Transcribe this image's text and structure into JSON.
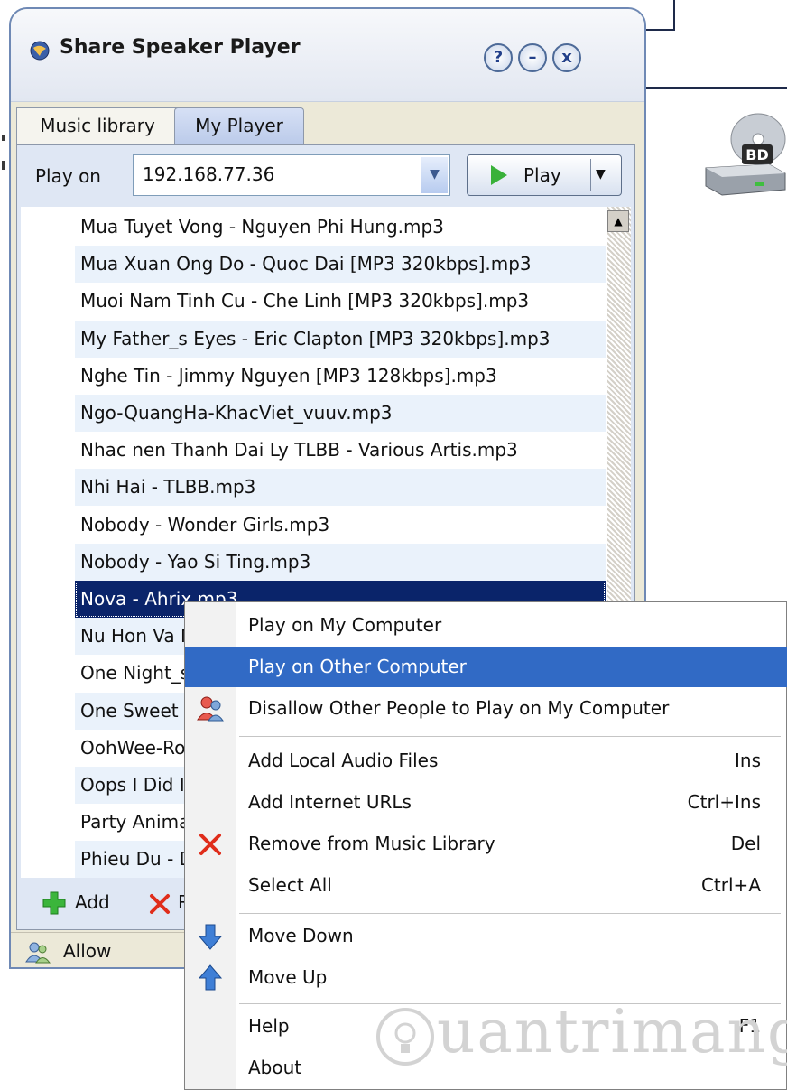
{
  "window": {
    "title": "Share Speaker Player",
    "buttons": {
      "help": "?",
      "minimize": "–",
      "close": "x"
    }
  },
  "tabs": [
    {
      "label": "Music library",
      "active": false
    },
    {
      "label": "My Player",
      "active": true
    }
  ],
  "toolbar": {
    "play_on_label": "Play on",
    "ip_value": "192.168.77.36",
    "play_label": "Play"
  },
  "tracks": [
    "Mua Tuyet Vong - Nguyen Phi Hung.mp3",
    "Mua Xuan Ong Do - Quoc Dai [MP3 320kbps].mp3",
    "Muoi Nam Tinh Cu - Che Linh [MP3 320kbps].mp3",
    "My Father_s Eyes - Eric Clapton [MP3 320kbps].mp3",
    "Nghe Tin - Jimmy Nguyen [MP3 128kbps].mp3",
    "Ngo-QuangHa-KhacViet_vuuv.mp3",
    "Nhac nen Thanh Dai Ly TLBB - Various Artis.mp3",
    "Nhi Hai - TLBB.mp3",
    "Nobody - Wonder Girls.mp3",
    "Nobody - Yao Si Ting.mp3",
    "Nova - Ahrix.mp3",
    "Nu Hon Va N",
    "One Night_s",
    "One Sweet D",
    "OohWee-Ro",
    "Oops I Did It",
    "Party Animal",
    "Phieu Du - D"
  ],
  "selected_index": 10,
  "bottom": {
    "add_label": "Add",
    "remove_label": "R"
  },
  "status": {
    "allow_label": "Allow"
  },
  "context_menu": {
    "play_on_my_computer": "Play on My Computer",
    "play_on_other_computer": "Play on Other Computer",
    "disallow": "Disallow Other People to Play on My Computer",
    "add_local": "Add Local Audio Files",
    "add_local_key": "Ins",
    "add_urls": "Add Internet URLs",
    "add_urls_key": "Ctrl+Ins",
    "remove": "Remove from Music Library",
    "remove_key": "Del",
    "select_all": "Select All",
    "select_all_key": "Ctrl+A",
    "move_down": "Move Down",
    "move_up": "Move Up",
    "help": "Help",
    "help_key": "F1",
    "about": "About"
  },
  "watermark": "uantrimang",
  "desktop": {
    "drive_badge": "BD"
  },
  "colors": {
    "selection": "#0a246a",
    "menu_highlight": "#316ac5",
    "accent": "#6f89b5"
  }
}
